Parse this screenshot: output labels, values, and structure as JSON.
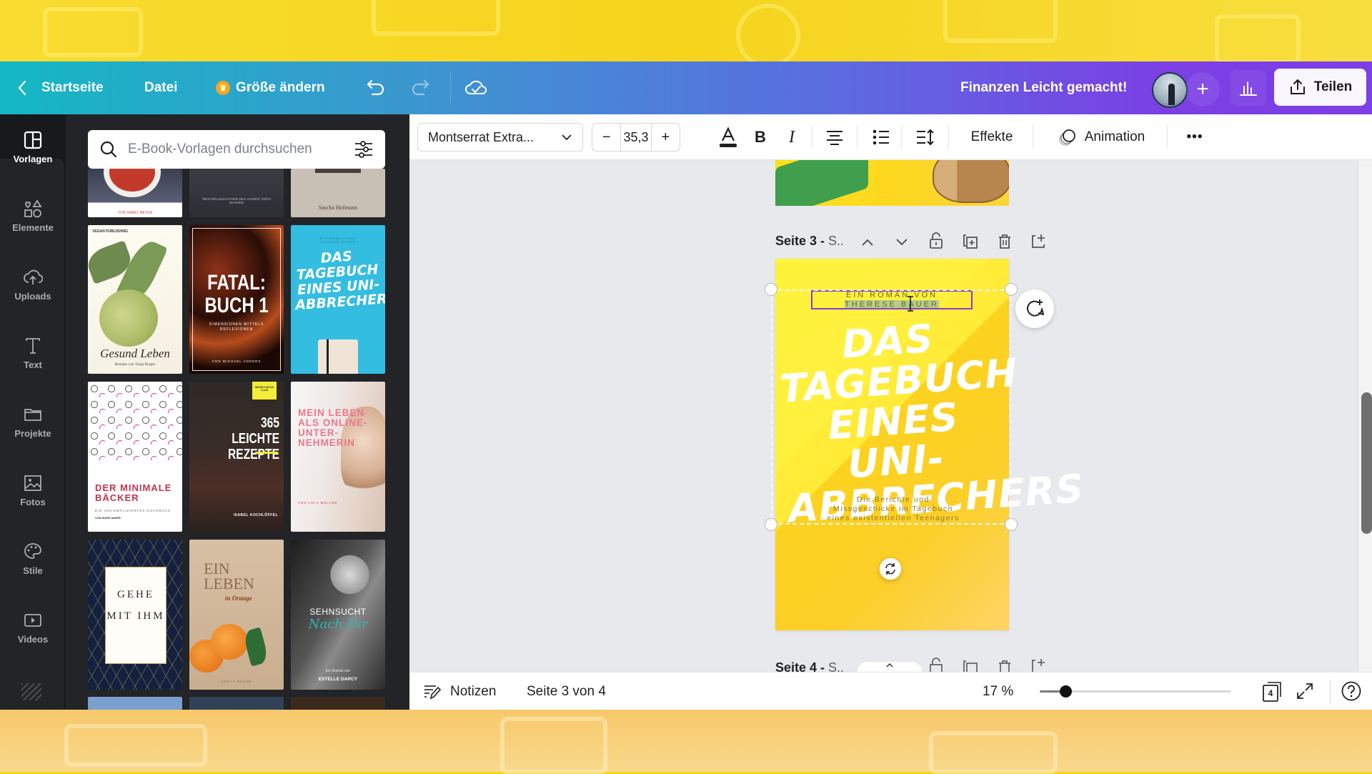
{
  "header": {
    "back_label": "Startseite",
    "file_label": "Datei",
    "resize_label": "Größe ändern",
    "project_title": "Finanzen Leicht gemacht!",
    "share_label": "Teilen",
    "colors": {
      "gradient_start": "#14b8c4",
      "gradient_end": "#7d3ee6"
    }
  },
  "sidebar": {
    "items": [
      {
        "label": "Vorlagen",
        "icon": "templates-icon",
        "active": true
      },
      {
        "label": "Elemente",
        "icon": "elements-icon"
      },
      {
        "label": "Uploads",
        "icon": "upload-cloud-icon"
      },
      {
        "label": "Text",
        "icon": "text-icon"
      },
      {
        "label": "Projekte",
        "icon": "folder-icon"
      },
      {
        "label": "Fotos",
        "icon": "photo-icon"
      },
      {
        "label": "Stile",
        "icon": "palette-icon"
      },
      {
        "label": "Videos",
        "icon": "video-icon"
      }
    ]
  },
  "templates": {
    "search_placeholder": "E-Book-Vorlagen durchsuchen",
    "items": [
      {
        "title": "",
        "author": "VON ISABEL MEYER"
      },
      {
        "title": "",
        "subtitle": "\"BESTSELLERAUTORIN DES JAHRES\" SOFIA WAGNER"
      },
      {
        "title": "",
        "author": "Sascha Hofmann"
      },
      {
        "title": "Gesund Leben",
        "author": "Rezepte von Tanja Berger",
        "publisher": "VEGAN PUBLISHING"
      },
      {
        "title": "FATAL: BUCH 1",
        "subtitle": "DIMENSIONEN MITTELS REFLEXIONEN",
        "author": "VON MICHAEL ANDERS"
      },
      {
        "title": "DAS TAGEBUCH EINES UNI-ABBRECHERS",
        "author": "EIN ROMAN VON THERESE BAUER"
      },
      {
        "title": "DER MINIMALE BÄCKER",
        "subtitle": "EIN UNKOMPLIZIERTES KOCHBUCH",
        "author": "VON MARK MAIER"
      },
      {
        "title": "365 LEICHTE REZEPTE",
        "author": "ISABEL KOCHLÖFFEL",
        "badge": "WASELN BOOK CLUB"
      },
      {
        "title": "MEIN LEBEN ALS ONLINE-UNTER-NEHMERIN",
        "author": "VON LOLA MÜLLER"
      },
      {
        "title": "GEHE MIT IHM",
        "subtitle": ""
      },
      {
        "title": "EIN LEBEN",
        "subtitle": "in Orange",
        "author": "GRETA BÖHME"
      },
      {
        "title": "SEHNSUCHT",
        "subtitle": "Nach Dir",
        "author": "ESTELLE DARCY",
        "tagline": "Ein Roman von"
      }
    ]
  },
  "toolbar": {
    "font_name": "Montserrat Extra...",
    "font_size": "35,3",
    "minus_label": "−",
    "plus_label": "+",
    "effects_label": "Effekte",
    "animation_label": "Animation",
    "more_label": "•••"
  },
  "canvas": {
    "page3_label": "Seite 3 -",
    "page3_title": "S..",
    "page4_label": "Seite 4 -",
    "page4_title": "S..",
    "cover": {
      "byline_1": "EIN ROMAN VON",
      "byline_2": "THERESE BAUER",
      "title": "DAS TAGEBUCH EINES UNI-ABBRECHERS",
      "subtitle_1": "Die Berichte und",
      "subtitle_2": "Missgeschicke im Tagebuch",
      "subtitle_3": "eines existentiellen Teenagers"
    }
  },
  "bottom": {
    "notes_label": "Notizen",
    "page_indicator": "Seite 3 von 4",
    "zoom_label": "17 %",
    "zoom_value_percent": 17,
    "page_count": "4"
  }
}
